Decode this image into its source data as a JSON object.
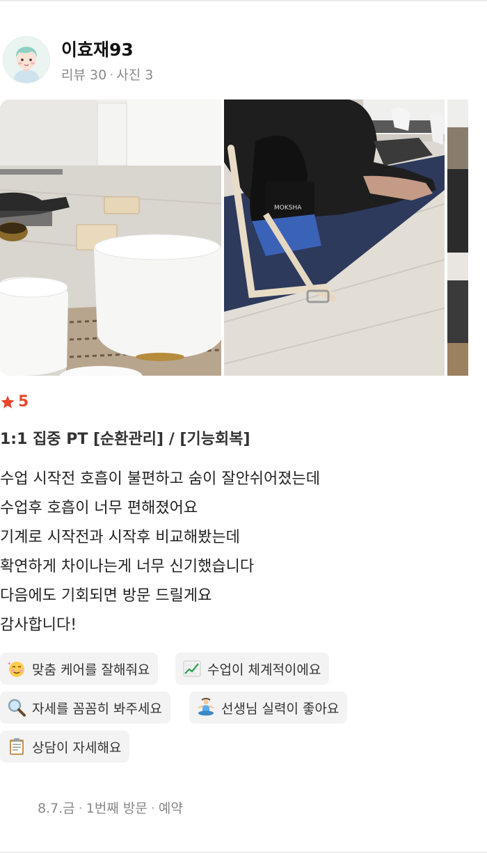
{
  "user": {
    "name": "이효재93",
    "reviews": "리뷰 30",
    "separator": "·",
    "photos": "사진 3"
  },
  "review": {
    "rating": "5",
    "product": "1:1 집중 PT [순환관리] / [기능회복]",
    "lines": [
      "수업 시작전 호흡이 불편하고 숨이 잘안쉬어졌는데",
      "수업후 호흡이 너무 편해졌어요",
      "기계로 시작전과 시작후 비교해봤는데",
      "확연하게 차이나는게 너무 신기했습니다",
      "다음에도 기회되면 방문 드릴게요",
      "감사합니다!"
    ]
  },
  "photos_text": {
    "mat_brand": "MOKSHA"
  },
  "tags": [
    {
      "icon": "smiling-face-icon",
      "label": "맞춤 케어를 잘해줘요"
    },
    {
      "icon": "chart-increasing-icon",
      "label": "수업이 체계적이에요"
    },
    {
      "icon": "magnifying-glass-icon",
      "label": "자세를 꼼꼼히 봐주세요"
    },
    {
      "icon": "person-meditating-icon",
      "label": "선생님 실력이 좋아요"
    },
    {
      "icon": "clipboard-icon",
      "label": "상담이 자세해요"
    }
  ],
  "footer": {
    "date": "8.7.금",
    "visit": "1번째 방문",
    "type": "예약",
    "separator": "·"
  },
  "colors": {
    "accent": "#e8482f",
    "tag_bg": "#f3f3f3",
    "meta": "#888888"
  }
}
